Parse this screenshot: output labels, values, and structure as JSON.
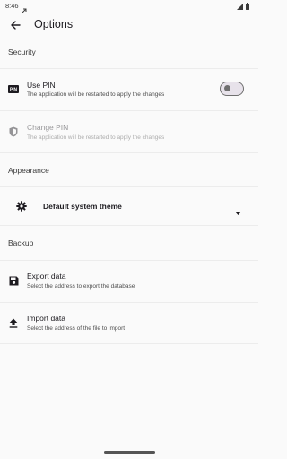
{
  "status": {
    "time": "8:46"
  },
  "appbar": {
    "title": "Options"
  },
  "security": {
    "header": "Security",
    "use_pin": {
      "title": "Use PIN",
      "subtitle": "The application will be restarted to apply the changes",
      "icon_text": "PIN",
      "enabled": false
    },
    "change_pin": {
      "title": "Change PIN",
      "subtitle": "The application will be restarted to apply the changes"
    }
  },
  "appearance": {
    "header": "Appearance",
    "theme": {
      "selected": "Default system theme"
    }
  },
  "backup": {
    "header": "Backup",
    "export": {
      "title": "Export data",
      "subtitle": "Select the address to export the database"
    },
    "import": {
      "title": "Import data",
      "subtitle": "Select the address of the file to import"
    }
  }
}
